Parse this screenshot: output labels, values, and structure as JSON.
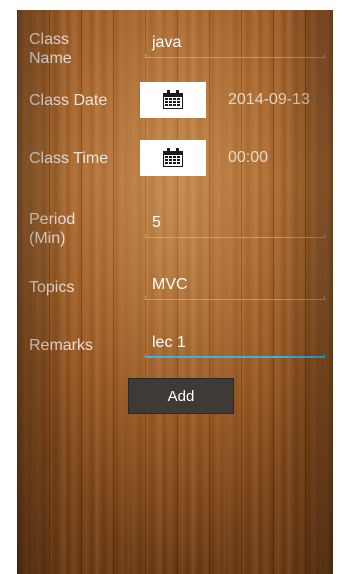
{
  "form": {
    "class_name": {
      "label": "Class Name",
      "value": "java"
    },
    "class_date": {
      "label": "Class Date",
      "value": "2014-09-13",
      "icon": "calendar-icon"
    },
    "class_time": {
      "label": "Class Time",
      "value": "00:00",
      "icon": "calendar-icon"
    },
    "period": {
      "label": "Period (Min)",
      "value": "5"
    },
    "topics": {
      "label": "Topics",
      "value": "MVC"
    },
    "remarks": {
      "label": "Remarks",
      "value": "lec 1"
    },
    "add_label": "Add"
  },
  "colors": {
    "focus_underline": "#33b5e5",
    "button_bg": "#3d3a38"
  }
}
